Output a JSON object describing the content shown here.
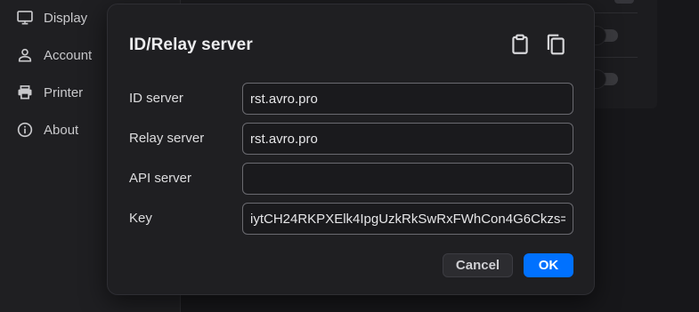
{
  "sidebar": {
    "items": [
      {
        "label": "Display",
        "icon": "monitor-icon"
      },
      {
        "label": "Account",
        "icon": "person-icon"
      },
      {
        "label": "Printer",
        "icon": "printer-icon"
      },
      {
        "label": "About",
        "icon": "info-icon"
      }
    ]
  },
  "dialog": {
    "title": "ID/Relay server",
    "icons": [
      "clipboard-paste-icon",
      "copy-icon"
    ],
    "fields": [
      {
        "label": "ID server",
        "value": "rst.avro.pro",
        "placeholder": ""
      },
      {
        "label": "Relay server",
        "value": "rst.avro.pro",
        "placeholder": ""
      },
      {
        "label": "API server",
        "value": "",
        "placeholder": ""
      },
      {
        "label": "Key",
        "value": "iytCH24RKPXElk4IpgUzkRkSwRxFWhCon4G6Ckzs=",
        "placeholder": ""
      }
    ],
    "cancel_label": "Cancel",
    "ok_label": "OK"
  },
  "colors": {
    "accent": "#0071ff",
    "dialog_bg": "#1f1f22",
    "page_bg": "#17171a"
  }
}
